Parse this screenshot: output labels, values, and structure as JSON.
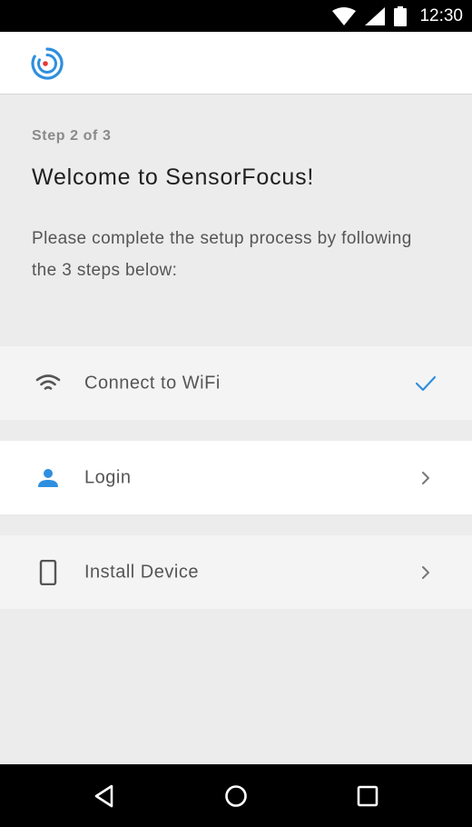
{
  "status_bar": {
    "time": "12:30",
    "icons": [
      "wifi-signal-icon",
      "cellular-signal-icon",
      "battery-icon"
    ]
  },
  "header": {
    "logo": "sensorfocus-logo",
    "brand_colors": {
      "blue": "#2f8fdf",
      "red": "#e53935"
    }
  },
  "intro": {
    "step_label": "Step 2 of 3",
    "title": "Welcome to SensorFocus!",
    "description": "Please complete the setup process by following the 3 steps below:"
  },
  "steps": [
    {
      "label": "Connect to WiFi",
      "icon": "wifi-icon",
      "status_icon": "checkmark-icon",
      "state": "completed"
    },
    {
      "label": "Login",
      "icon": "person-icon",
      "status_icon": "chevron-right-icon",
      "state": "active"
    },
    {
      "label": "Install Device",
      "icon": "phone-device-icon",
      "status_icon": "chevron-right-icon",
      "state": "pending"
    }
  ],
  "nav_bar": {
    "buttons": [
      "back-icon",
      "home-icon",
      "recents-icon"
    ]
  },
  "colors": {
    "accent": "#2f8fdf",
    "icon_gray": "#555555",
    "chevron_gray": "#777777",
    "background": "#ececec"
  }
}
